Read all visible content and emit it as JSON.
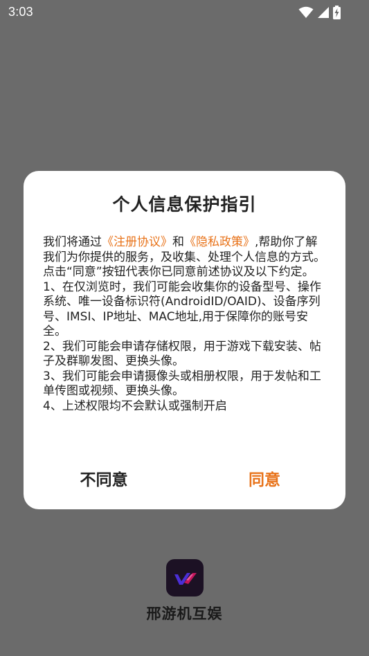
{
  "status_bar": {
    "time": "3:03",
    "icons": [
      "wifi-icon",
      "signal-icon",
      "battery-charging-icon"
    ]
  },
  "dialog": {
    "title": "个人信息保护指引",
    "intro_prefix": "我们将通过",
    "link_terms": "《注册协议》",
    "intro_and": "和",
    "link_privacy": "《隐私政策》",
    "intro_suffix": ",帮助你了解我们为你提供的服务，及收集、处理个人信息的方式。",
    "paragraphs": [
      " 点击“同意”按钮代表你已同意前述协议及以下约定。",
      " 1、在仅浏览时，我们可能会收集你的设备型号、操作系统、唯一设备标识符(AndroidID/OAID)、设备序列号、IMSI、IP地址、MAC地址,用于保障你的账号安全。",
      " 2、我们可能会申请存储权限，用于游戏下载安装、帖子及群聊发图、更换头像。",
      " 3、我们可能会申请摄像头或相册权限，用于发帖和工单传图或视频、更换头像。",
      " 4、上述权限均不会默认或强制开启"
    ],
    "disagree_label": "不同意",
    "agree_label": "同意"
  },
  "app": {
    "name": "邢游机互娱"
  },
  "colors": {
    "overlay_background": "#6b6b6b",
    "accent": "#e8731a",
    "text": "#222222",
    "dialog_background": "#ffffff"
  }
}
